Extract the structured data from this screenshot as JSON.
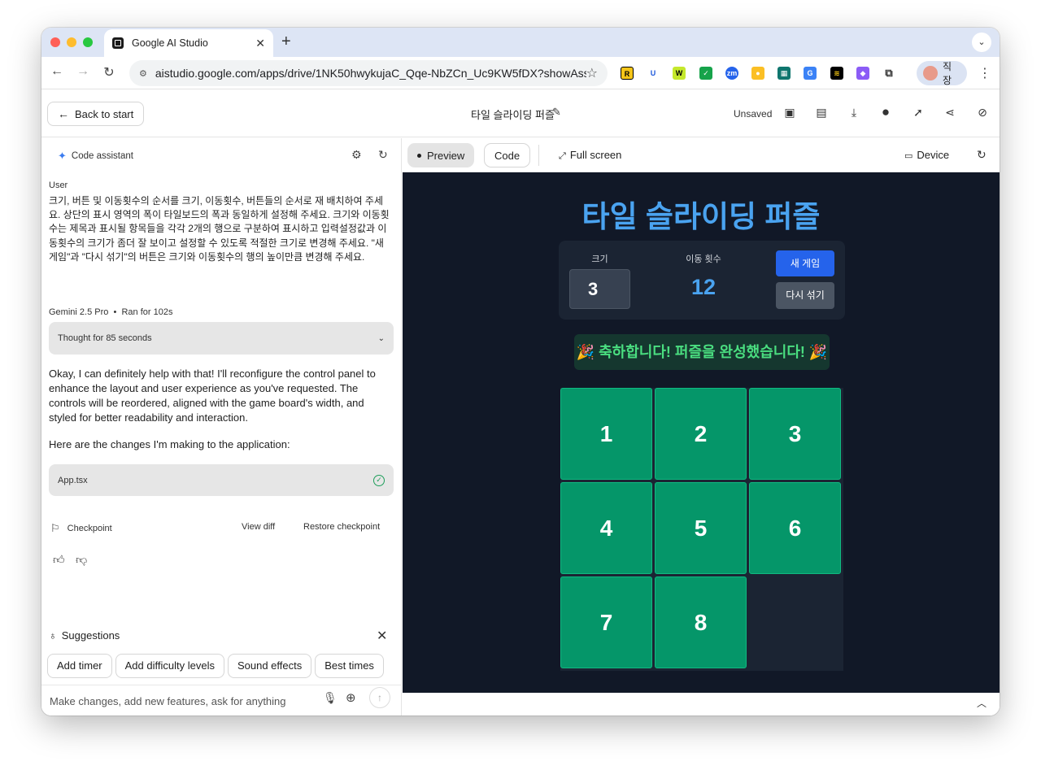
{
  "browser": {
    "tab_title": "Google AI Studio",
    "url": "aistudio.google.com/apps/drive/1NK50hwykujaC_Qqe-NbZCn_Uc9KW5fDX?showAss...",
    "profile_label": "직장"
  },
  "header": {
    "back_label": "Back to start",
    "project_title": "타일 슬라이딩 퍼즐",
    "unsaved_label": "Unsaved"
  },
  "chat": {
    "assistant_label": "Code assistant",
    "user_label": "User",
    "user_message": "크기, 버튼 및 이동횟수의 순서를 크기, 이동횟수, 버튼들의 순서로 재 배치하여 주세요. 상단의 표시 영역의 폭이 타일보드의 폭과 동일하게 설정해 주세요. 크기와 이동횟수는 제목과 표시될 항목들을 각각 2개의 행으로 구분하여 표시하고 입력설정값과 이동횟수의 크기가 좀더 잘 보이고 설정할 수 있도록 적절한 크기로 변경해 주세요. \"새 게임\"과 \"다시 섞기\"의 버튼은 크기와 이동횟수의 행의 높이만큼 변경해 주세요.",
    "model_name": "Gemini 2.5 Pro",
    "run_time": "Ran for 102s",
    "thought_label": "Thought for 85 seconds",
    "assistant_message": "Okay, I can definitely help with that! I'll reconfigure the control panel to enhance the layout and user experience as you've requested. The controls will be reordered, aligned with the game board's width, and styled for better readability and interaction.",
    "assistant_message2": "Here are the changes I'm making to the application:",
    "file_name": "App.tsx",
    "checkpoint_label": "Checkpoint",
    "view_diff_label": "View diff",
    "restore_label": "Restore checkpoint",
    "suggestions_label": "Suggestions",
    "suggestions": [
      "Add timer",
      "Add difficulty levels",
      "Sound effects",
      "Best times"
    ],
    "prompt_placeholder": "Make changes, add new features, ask for anything"
  },
  "preview": {
    "tab_preview": "Preview",
    "tab_code": "Code",
    "fullscreen_label": "Full screen",
    "device_label": "Device"
  },
  "game": {
    "title": "타일 슬라이딩 퍼즐",
    "size_label": "크기",
    "size_value": "3",
    "moves_label": "이동 횟수",
    "moves_value": "12",
    "new_game_label": "새 게임",
    "shuffle_label": "다시 섞기",
    "congrats": "🎉 축하합니다! 퍼즐을 완성했습니다! 🎉",
    "tiles": [
      "1",
      "2",
      "3",
      "4",
      "5",
      "6",
      "7",
      "8"
    ]
  }
}
